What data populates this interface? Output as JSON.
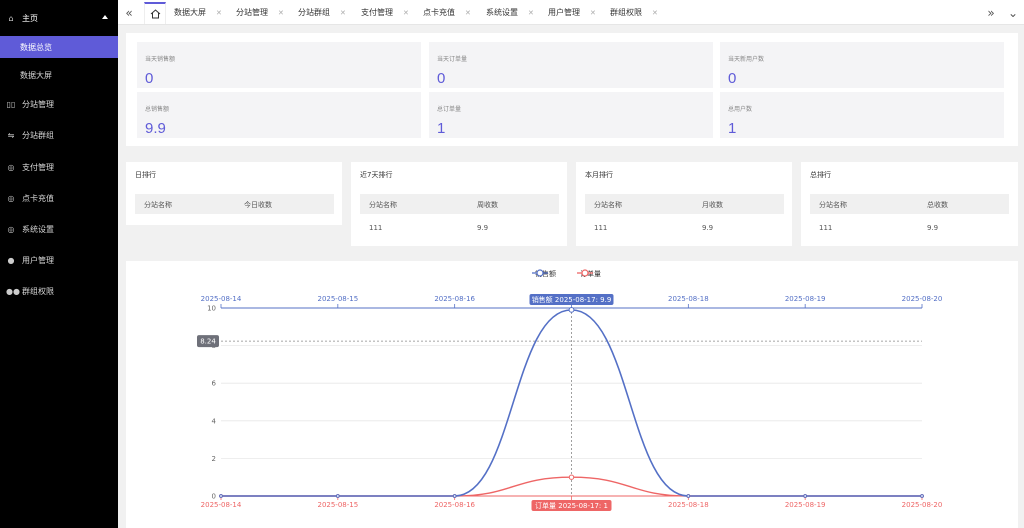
{
  "sidebar": {
    "home": "主页",
    "sub_items": [
      "数据总览",
      "数据大屏"
    ],
    "items": [
      {
        "label": "分站管理",
        "icon": "columns-icon"
      },
      {
        "label": "分站群组",
        "icon": "sliders-icon"
      },
      {
        "label": "支付管理",
        "icon": "shield-icon"
      },
      {
        "label": "点卡充值",
        "icon": "shield-icon"
      },
      {
        "label": "系统设置",
        "icon": "shield-icon"
      },
      {
        "label": "用户管理",
        "icon": "user-icon"
      },
      {
        "label": "群组权限",
        "icon": "users-icon"
      }
    ]
  },
  "tabs": [
    {
      "label": "数据大屏"
    },
    {
      "label": "分站管理"
    },
    {
      "label": "分站群组"
    },
    {
      "label": "支付管理"
    },
    {
      "label": "点卡充值"
    },
    {
      "label": "系统设置"
    },
    {
      "label": "用户管理"
    },
    {
      "label": "群组权限"
    }
  ],
  "stats": [
    {
      "label": "当天销售额",
      "value": "0"
    },
    {
      "label": "当天订单量",
      "value": "0"
    },
    {
      "label": "当天新用户数",
      "value": "0"
    },
    {
      "label": "总销售额",
      "value": "9.9"
    },
    {
      "label": "总订单量",
      "value": "1"
    },
    {
      "label": "总用户数",
      "value": "1"
    }
  ],
  "rankings": [
    {
      "title": "日排行",
      "col1": "分站名称",
      "col2": "今日收数",
      "rows": []
    },
    {
      "title": "近7天排行",
      "col1": "分站名称",
      "col2": "周收数",
      "rows": [
        [
          "111",
          "9.9"
        ]
      ]
    },
    {
      "title": "本月排行",
      "col1": "分站名称",
      "col2": "月收数",
      "rows": [
        [
          "111",
          "9.9"
        ]
      ]
    },
    {
      "title": "总排行",
      "col1": "分站名称",
      "col2": "总收数",
      "rows": [
        [
          "111",
          "9.9"
        ]
      ]
    }
  ],
  "colors": {
    "accent": "#5f5bd8",
    "sales": "#5470c6",
    "orders": "#ee6666"
  },
  "chart_data": {
    "type": "line",
    "x": [
      "2025-08-14",
      "2025-08-15",
      "2025-08-16",
      "2025-08-17",
      "2025-08-18",
      "2025-08-19",
      "2025-08-20"
    ],
    "series": [
      {
        "name": "销售额",
        "values": [
          0,
          0,
          0,
          9.9,
          0,
          0,
          0
        ]
      },
      {
        "name": "订单量",
        "values": [
          0,
          0,
          0,
          1,
          0,
          0,
          0
        ]
      }
    ],
    "yticks": [
      "0",
      "2",
      "4",
      "6",
      "8",
      "10"
    ],
    "ylim": [
      0,
      10
    ],
    "smooth": true,
    "legend": "top-center",
    "crosshair_value": "8.24",
    "tooltip_top": "销售额  2025-08-17: 9.9",
    "tooltip_bottom": "订单量  2025-08-17: 1"
  }
}
